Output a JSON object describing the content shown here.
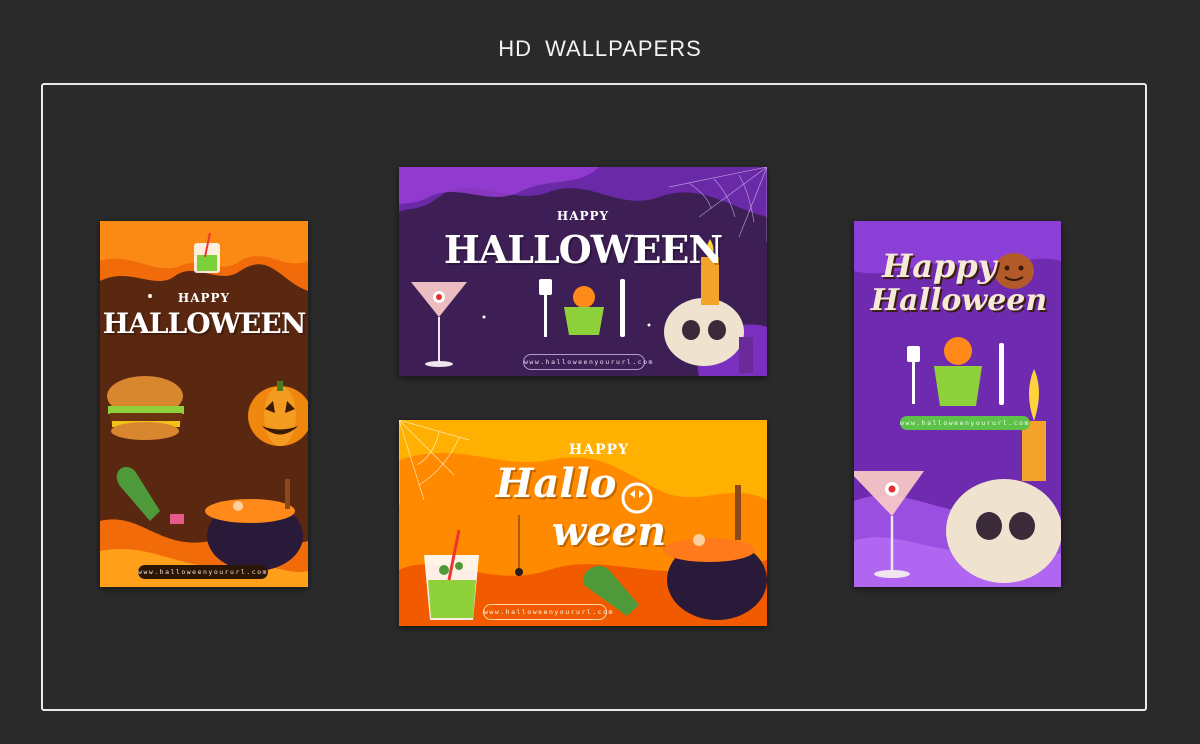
{
  "page": {
    "title": "HD WALLPAPERS"
  },
  "wallpapers": [
    {
      "id": "portrait-orange",
      "happy": "HAPPY",
      "headline": "HALLOWEEN",
      "url": "www.halloweenyoururl.com",
      "colors": {
        "primary": "#f26b0a",
        "secondary": "#5a2710",
        "accent": "#ff9f1a"
      }
    },
    {
      "id": "landscape-purple",
      "happy": "HAPPY",
      "headline": "HALLOWEEN",
      "url": "www.halloweenyoururl.com",
      "colors": {
        "primary": "#6a2aa8",
        "secondary": "#3e1f55",
        "accent": "#9b3ed8"
      }
    },
    {
      "id": "landscape-orange",
      "happy": "HAPPY",
      "headline_line1": "Hallo",
      "headline_line2": "ween",
      "url": "www.halloweenyoururl.com",
      "colors": {
        "primary": "#ff8a00",
        "secondary": "#ffb000",
        "accent": "#f25a00"
      }
    },
    {
      "id": "portrait-purple",
      "headline_line1": "Happy",
      "headline_line2": "Halloween",
      "url": "www.halloweenyoururl.com",
      "colors": {
        "primary": "#6f2bb0",
        "secondary": "#8b3fd6",
        "accent": "#5ec24a"
      }
    }
  ]
}
